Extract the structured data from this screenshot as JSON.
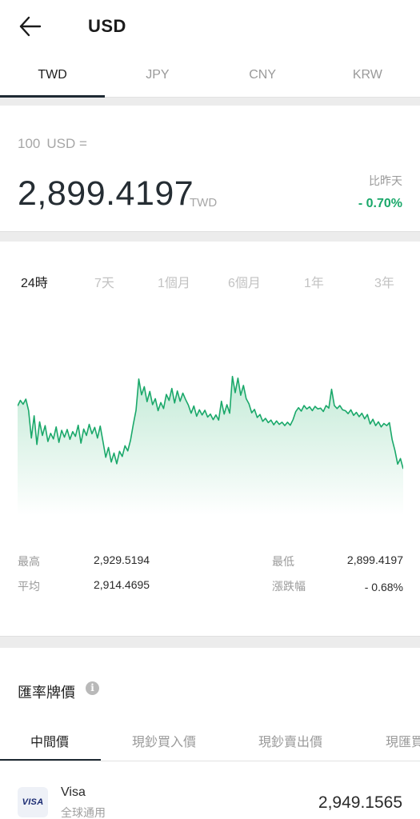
{
  "header": {
    "title": "USD"
  },
  "currency_tabs": [
    {
      "label": "TWD",
      "active": true
    },
    {
      "label": "JPY",
      "active": false
    },
    {
      "label": "CNY",
      "active": false
    },
    {
      "label": "KRW",
      "active": false
    }
  ],
  "rate": {
    "base_amount": "100",
    "base_currency": "USD =",
    "value": "2,899.4197",
    "unit": "TWD",
    "compare_label": "比昨天",
    "compare_value": "- 0.70%"
  },
  "range_tabs": [
    {
      "label": "24時",
      "active": true
    },
    {
      "label": "7天",
      "active": false
    },
    {
      "label": "1個月",
      "active": false
    },
    {
      "label": "6個月",
      "active": false
    },
    {
      "label": "1年",
      "active": false
    },
    {
      "label": "3年",
      "active": false
    }
  ],
  "chart_data": {
    "type": "area",
    "title": "",
    "color": "#1aa86a",
    "fill_color_top": "#bfe9d4",
    "fill_color_bottom": "#ffffff",
    "ylim": [
      2896,
      2936
    ],
    "values": [
      2921.5,
      2922.8,
      2921.9,
      2923.1,
      2920.4,
      2914.0,
      2919.2,
      2912.5,
      2917.8,
      2914.6,
      2916.9,
      2913.2,
      2915.1,
      2913.8,
      2916.6,
      2913.0,
      2915.8,
      2914.2,
      2916.0,
      2913.7,
      2915.5,
      2914.4,
      2917.0,
      2912.8,
      2916.1,
      2914.6,
      2917.2,
      2915.0,
      2916.5,
      2914.0,
      2916.8,
      2913.2,
      2909.5,
      2911.8,
      2908.4,
      2910.5,
      2908.0,
      2910.9,
      2909.7,
      2912.2,
      2911.0,
      2913.5,
      2917.2,
      2920.5,
      2927.8,
      2924.1,
      2926.0,
      2922.5,
      2924.9,
      2921.8,
      2923.2,
      2920.4,
      2922.3,
      2920.9,
      2924.2,
      2922.8,
      2925.6,
      2922.2,
      2925.0,
      2922.6,
      2924.5,
      2923.0,
      2921.7,
      2919.8,
      2921.5,
      2919.1,
      2920.6,
      2919.4,
      2920.5,
      2918.9,
      2919.6,
      2918.3,
      2919.4,
      2918.2,
      2922.6,
      2919.6,
      2921.8,
      2919.8,
      2928.4,
      2924.6,
      2928.0,
      2924.0,
      2926.3,
      2923.2,
      2922.0,
      2919.9,
      2920.7,
      2918.8,
      2919.5,
      2917.9,
      2918.6,
      2917.6,
      2918.2,
      2917.1,
      2918.0,
      2917.2,
      2917.7,
      2916.9,
      2917.7,
      2917.0,
      2918.3,
      2920.2,
      2921.1,
      2920.3,
      2921.6,
      2920.8,
      2921.3,
      2920.4,
      2921.4,
      2920.8,
      2921.0,
      2920.2,
      2921.6,
      2921.0,
      2925.4,
      2921.6,
      2920.9,
      2921.6,
      2920.6,
      2920.4,
      2919.7,
      2920.6,
      2919.3,
      2920.0,
      2919.0,
      2919.8,
      2918.5,
      2919.5,
      2917.3,
      2918.4,
      2916.9,
      2917.8,
      2916.6,
      2917.4,
      2916.9,
      2917.6,
      2913.6,
      2911.1,
      2907.9,
      2909.2,
      2906.8
    ]
  },
  "stats": {
    "high_label": "最高",
    "high_value": "2,929.5194",
    "low_label": "最低",
    "low_value": "2,899.4197",
    "avg_label": "平均",
    "avg_value": "2,914.4695",
    "change_label": "漲跌幅",
    "change_value": "- 0.68%"
  },
  "rates_section": {
    "title": "匯率牌價",
    "info_icon": "info-icon",
    "tabs": [
      {
        "label": "中間價",
        "active": true
      },
      {
        "label": "現鈔買入價",
        "active": false
      },
      {
        "label": "現鈔賣出價",
        "active": false
      },
      {
        "label": "現匯買",
        "active": false
      }
    ],
    "rows": [
      {
        "logo": "VISA",
        "name": "Visa",
        "sub": "全球通用",
        "value": "2,949.1565"
      }
    ]
  }
}
